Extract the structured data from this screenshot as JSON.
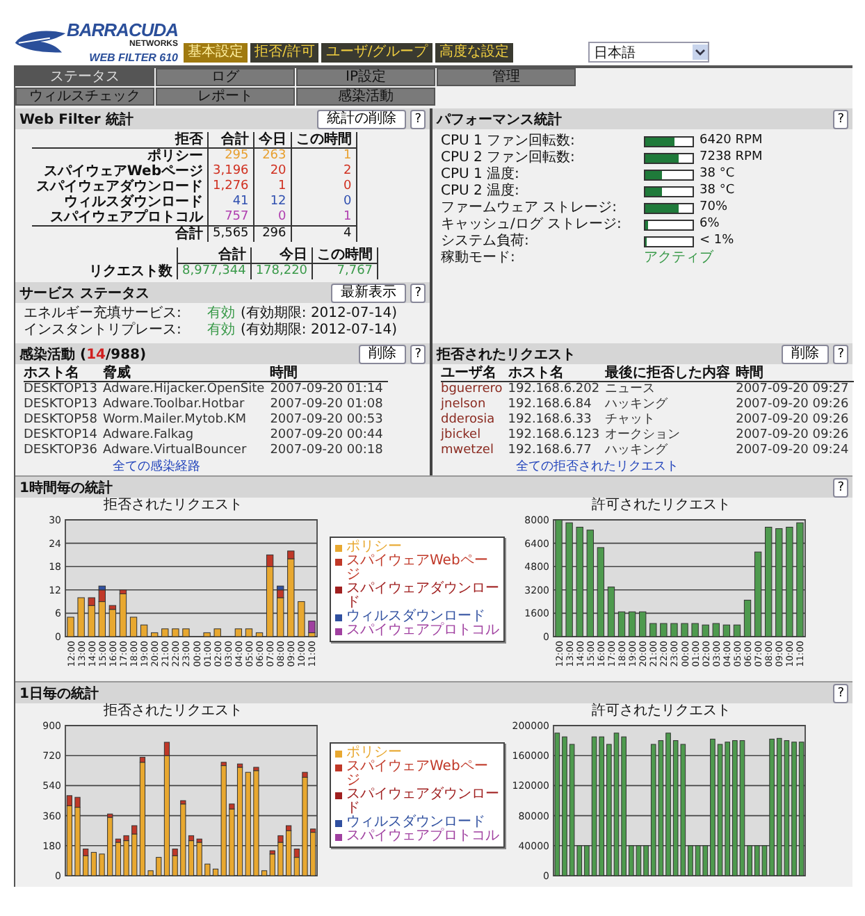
{
  "logo": {
    "brand": "BARRACUDA",
    "company": "NETWORKS",
    "product": "WEB FILTER 610"
  },
  "main_tabs": [
    {
      "label": "基本設定",
      "selected": true
    },
    {
      "label": "拒否/許可",
      "selected": false
    },
    {
      "label": "ユーザ/グループ",
      "selected": false
    },
    {
      "label": "高度な設定",
      "selected": false
    }
  ],
  "language_select": {
    "value": "日本語"
  },
  "sub_tabs": [
    {
      "label": "ステータス",
      "selected": true
    },
    {
      "label": "ログ",
      "selected": false
    },
    {
      "label": "IP設定",
      "selected": false
    },
    {
      "label": "管理",
      "selected": false
    },
    {
      "label": "ウィルスチェック",
      "selected": false
    },
    {
      "label": "レポート",
      "selected": false
    },
    {
      "label": "感染活動",
      "selected": false
    }
  ],
  "web_filter_stats": {
    "title": "Web Filter 統計",
    "clear_button": "統計の削除",
    "help_button": "?",
    "columns": [
      "拒否",
      "合計",
      "今日",
      "この時間"
    ],
    "rows": [
      {
        "label": "ポリシー",
        "color": "#e8a030",
        "values": [
          "295",
          "263",
          "1"
        ]
      },
      {
        "label": "スパイウェアWebページ",
        "color": "#d03020",
        "values": [
          "3,196",
          "20",
          "2"
        ]
      },
      {
        "label": "スパイウェアダウンロード",
        "color": "#d03020",
        "values": [
          "1,276",
          "1",
          "0"
        ]
      },
      {
        "label": "ウィルスダウンロード",
        "color": "#3050b0",
        "values": [
          "41",
          "12",
          "0"
        ]
      },
      {
        "label": "スパイウェアプロトコル",
        "color": "#b040b0",
        "values": [
          "757",
          "0",
          "1"
        ]
      }
    ],
    "total_row": {
      "label": "合計",
      "values": [
        "5,565",
        "296",
        "4"
      ]
    },
    "request_columns": [
      "合計",
      "今日",
      "この時間"
    ],
    "request_row": {
      "label": "リクエスト数",
      "values": [
        "8,977,344",
        "178,220",
        "7,767"
      ]
    }
  },
  "service_status": {
    "title": "サービス ステータス",
    "refresh_button": "最新表示",
    "help_button": "?",
    "items": [
      {
        "label": "エネルギー充填サービス:",
        "status": "有効",
        "expiry": "(有効期限: 2012-07-14)"
      },
      {
        "label": "インスタントリプレース:",
        "status": "有効",
        "expiry": "(有効期限: 2012-07-14)"
      }
    ]
  },
  "performance": {
    "title": "パフォーマンス統計",
    "help_button": "?",
    "items": [
      {
        "label": "CPU 1 ファン回転数:",
        "kind": "meter",
        "level": 0.62,
        "reading": "6420 RPM"
      },
      {
        "label": "CPU 2 ファン回転数:",
        "kind": "meter",
        "level": 0.7,
        "reading": "7238 RPM"
      },
      {
        "label": "CPU 1 温度:",
        "kind": "meter",
        "level": 0.35,
        "reading": "38 °C"
      },
      {
        "label": "CPU 2 温度:",
        "kind": "meter",
        "level": 0.35,
        "reading": "38 °C"
      },
      {
        "label": "ファームウェア ストレージ:",
        "kind": "meter",
        "level": 0.7,
        "reading": "70%"
      },
      {
        "label": "キャッシュ/ログ ストレージ:",
        "kind": "meter",
        "level": 0.06,
        "reading": "6%"
      },
      {
        "label": "システム負荷:",
        "kind": "meter",
        "level": 0.01,
        "reading": "< 1%"
      },
      {
        "label": "稼動モード:",
        "kind": "status",
        "value": "アクティブ"
      }
    ]
  },
  "infection_activity": {
    "title_parts": [
      {
        "text": "感染活動 (",
        "kind": "plain"
      },
      {
        "text": "14",
        "kind": "alert"
      },
      {
        "text": "/988)",
        "kind": "plain"
      }
    ],
    "delete_button": "削除",
    "help_button": "?",
    "columns": [
      "ホスト名",
      "脅威",
      "時間"
    ],
    "rows": [
      [
        "DESKTOP13",
        "Adware.Hijacker.OpenSite",
        "2007-09-20 01:14"
      ],
      [
        "DESKTOP13",
        "Adware.Toolbar.Hotbar",
        "2007-09-20 01:08"
      ],
      [
        "DESKTOP58",
        "Worm.Mailer.Mytob.KM",
        "2007-09-20 00:53"
      ],
      [
        "DESKTOP14",
        "Adware.Falkag",
        "2007-09-20 00:44"
      ],
      [
        "DESKTOP36",
        "Adware.VirtualBouncer",
        "2007-09-20 00:18"
      ]
    ],
    "link": "全ての感染経路"
  },
  "blocked_requests": {
    "title": "拒否されたリクエスト",
    "delete_button": "削除",
    "help_button": "?",
    "columns": [
      "ユーザ名",
      "ホスト名",
      "最後に拒否した内容",
      "時間"
    ],
    "rows": [
      [
        "bguerrero",
        "192.168.6.202",
        "ニュース",
        "2007-09-20 09:27"
      ],
      [
        "jnelson",
        "192.168.6.84",
        "ハッキング",
        "2007-09-20 09:26"
      ],
      [
        "dderosia",
        "192.168.6.33",
        "チャット",
        "2007-09-20 09:26"
      ],
      [
        "jbickel",
        "192.168.6.123",
        "オークション",
        "2007-09-20 09:26"
      ],
      [
        "mwetzel",
        "192.168.6.77",
        "ハッキング",
        "2007-09-20 09:24"
      ]
    ],
    "link": "全ての拒否されたリクエスト"
  },
  "hourly_stats": {
    "title": "1時間毎の統計",
    "help_button": "?",
    "blocked": {
      "chart_data": {
        "type": "bar",
        "title": "拒否されたリクエスト",
        "stacked": true,
        "grid": true,
        "categories": [
          "12:00",
          "13:00",
          "14:00",
          "15:00",
          "16:00",
          "17:00",
          "18:00",
          "19:00",
          "20:00",
          "21:00",
          "22:00",
          "23:00",
          "00:00",
          "01:00",
          "02:00",
          "03:00",
          "04:00",
          "05:00",
          "06:00",
          "07:00",
          "08:00",
          "09:00",
          "10:00",
          "11:00"
        ],
        "ylim": [
          0,
          30
        ],
        "yticks": [
          0,
          6,
          12,
          18,
          24,
          30
        ],
        "series": [
          {
            "name": "ポリシー",
            "color": "#e8a830",
            "values": [
              5,
              10,
              8,
              9,
              7,
              11,
              5,
              3,
              1,
              2,
              2,
              2,
              0,
              1,
              2,
              0,
              2,
              2,
              1,
              18,
              10,
              20,
              9,
              1
            ]
          },
          {
            "name": "スパイウェアWebページ",
            "color": "#c03828",
            "values": [
              0,
              0,
              2,
              3,
              1,
              1,
              0,
              0,
              0,
              0,
              0,
              0,
              0,
              0,
              0,
              0,
              0,
              0,
              0,
              3,
              2,
              2,
              0,
              0
            ]
          },
          {
            "name": "スパイウェアダウンロード",
            "color": "#a02020",
            "values": [
              0,
              0,
              0,
              0,
              0,
              0,
              0,
              0,
              0,
              0,
              0,
              0,
              0,
              0,
              0,
              0,
              0,
              0,
              0,
              0,
              0,
              0,
              0,
              0
            ]
          },
          {
            "name": "ウィルスダウンロード",
            "color": "#3050a0",
            "values": [
              0,
              0,
              0,
              1,
              0,
              0,
              0,
              0,
              0,
              0,
              0,
              0,
              0,
              0,
              0,
              0,
              0,
              0,
              0,
              0,
              1,
              0,
              0,
              0
            ]
          },
          {
            "name": "スパイウェアプロトコル",
            "color": "#a040a0",
            "values": [
              0,
              0,
              0,
              0,
              0,
              0,
              0,
              0,
              0,
              0,
              0,
              0,
              0,
              0,
              0,
              0,
              0,
              0,
              0,
              0,
              0,
              0,
              0,
              3
            ]
          }
        ]
      }
    },
    "allowed": {
      "chart_data": {
        "type": "bar",
        "title": "許可されたリクエスト",
        "grid": true,
        "categories": [
          "12:00",
          "13:00",
          "14:00",
          "15:00",
          "16:00",
          "17:00",
          "18:00",
          "19:00",
          "20:00",
          "21:00",
          "22:00",
          "23:00",
          "00:00",
          "01:00",
          "02:00",
          "03:00",
          "04:00",
          "05:00",
          "06:00",
          "07:00",
          "08:00",
          "09:00",
          "10:00",
          "11:00"
        ],
        "ylim": [
          0,
          8000
        ],
        "yticks": [
          0,
          1600,
          3200,
          4800,
          6400,
          8000
        ],
        "series": [
          {
            "color": "#4e9a4e",
            "values": [
              8000,
              7800,
              7500,
              7300,
              6100,
              3400,
              1700,
              1700,
              1700,
              900,
              900,
              900,
              900,
              900,
              800,
              900,
              800,
              800,
              2500,
              5800,
              7500,
              7400,
              7500,
              7800
            ]
          }
        ]
      }
    }
  },
  "daily_stats": {
    "title": "1日毎の統計",
    "help_button": "?",
    "blocked": {
      "chart_data": {
        "type": "bar",
        "title": "拒否されたリクエスト",
        "stacked": true,
        "grid": true,
        "ylim": [
          0,
          900
        ],
        "yticks": [
          0,
          180,
          360,
          540,
          720,
          900
        ],
        "series": [
          {
            "name": "ポリシー",
            "color": "#e8a830",
            "values": [
              420,
              410,
              120,
              140,
              130,
              350,
              200,
              210,
              250,
              680,
              30,
              110,
              720,
              120,
              430,
              210,
              200,
              70,
              40,
              660,
              400,
              650,
              620,
              630,
              30,
              130,
              200,
              270,
              110,
              590,
              260
            ]
          },
          {
            "name": "スパイウェアWebページ",
            "color": "#c03828",
            "values": [
              60,
              60,
              40,
              0,
              0,
              20,
              20,
              30,
              50,
              30,
              0,
              0,
              80,
              40,
              20,
              30,
              20,
              0,
              0,
              20,
              30,
              20,
              0,
              20,
              0,
              20,
              40,
              30,
              50,
              30,
              20
            ]
          },
          {
            "name": "スパイウェアダウンロード",
            "color": "#a02020",
            "values": [
              0,
              0,
              0,
              0,
              0,
              0,
              0,
              0,
              0,
              0,
              0,
              0,
              0,
              0,
              0,
              0,
              0,
              0,
              0,
              0,
              0,
              0,
              0,
              0,
              0,
              0,
              0,
              0,
              0,
              0,
              0
            ]
          },
          {
            "name": "ウィルスダウンロード",
            "color": "#3050a0",
            "values": [
              0,
              0,
              0,
              0,
              0,
              0,
              0,
              0,
              0,
              0,
              0,
              0,
              0,
              0,
              0,
              0,
              0,
              0,
              0,
              0,
              0,
              0,
              0,
              0,
              0,
              0,
              0,
              0,
              0,
              0,
              0
            ]
          },
          {
            "name": "スパイウェアプロトコル",
            "color": "#a040a0",
            "values": [
              0,
              0,
              0,
              0,
              0,
              0,
              0,
              0,
              0,
              0,
              0,
              0,
              0,
              0,
              0,
              0,
              0,
              0,
              0,
              0,
              0,
              0,
              0,
              0,
              0,
              0,
              0,
              0,
              0,
              0,
              0
            ]
          }
        ]
      }
    },
    "allowed": {
      "chart_data": {
        "type": "bar",
        "title": "許可されたリクエスト",
        "grid": true,
        "ylim": [
          0,
          200000
        ],
        "yticks": [
          0,
          40000,
          80000,
          120000,
          160000,
          200000
        ],
        "series": [
          {
            "color": "#4e9a4e",
            "values": [
              190000,
              185000,
              175000,
              40000,
              40000,
              185000,
              185000,
              175000,
              190000,
              185000,
              40000,
              40000,
              40000,
              175000,
              180000,
              190000,
              180000,
              175000,
              40000,
              40000,
              40000,
              182000,
              175000,
              178000,
              180000,
              180000,
              40000,
              40000,
              40000,
              182000,
              183000,
              180000,
              178000,
              178000
            ]
          }
        ]
      }
    }
  }
}
